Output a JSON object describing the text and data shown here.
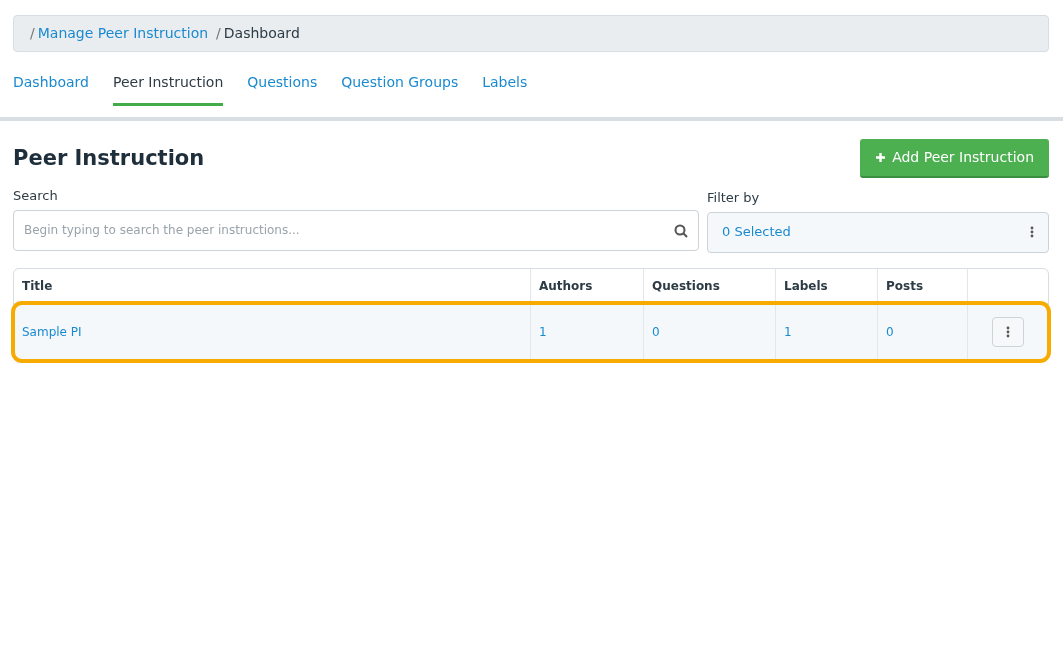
{
  "breadcrumb": [
    {
      "separator": "/",
      "label": "Manage Peer Instruction",
      "link": true
    },
    {
      "separator": "/",
      "label": "Dashboard",
      "link": false
    }
  ],
  "tabs": [
    {
      "label": "Dashboard",
      "selected": false
    },
    {
      "label": "Peer Instruction",
      "selected": true
    },
    {
      "label": "Questions",
      "selected": false
    },
    {
      "label": "Question Groups",
      "selected": false
    },
    {
      "label": "Labels",
      "selected": false
    }
  ],
  "heading": "Peer Instruction",
  "add_button": "Add Peer Instruction",
  "search": {
    "label": "Search",
    "placeholder": "Begin typing to search the peer instructions..."
  },
  "filter": {
    "label": "Filter by",
    "value": "0 Selected"
  },
  "table": {
    "columns": [
      "Title",
      "Authors",
      "Questions",
      "Labels",
      "Posts"
    ],
    "rows": [
      {
        "cells": [
          "Sample PI",
          "1",
          "0",
          "1",
          "0"
        ],
        "highlighted": true
      }
    ]
  }
}
